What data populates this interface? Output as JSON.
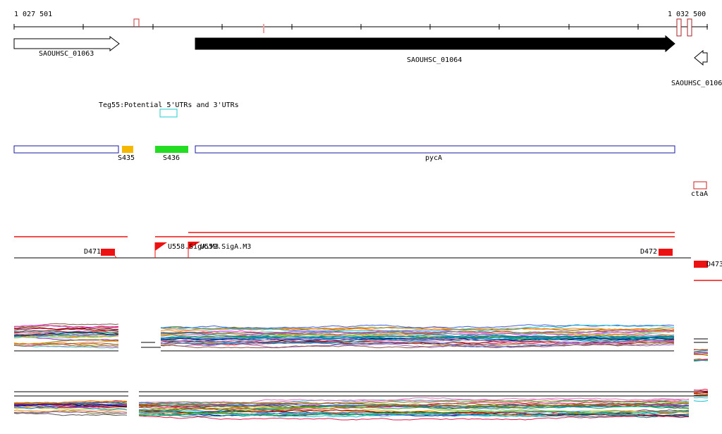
{
  "coords": {
    "start": "1 027 501",
    "end": "1 032 500"
  },
  "genes": [
    {
      "id": "SAOUHSC_01063",
      "label": "SAOUHSC_01063"
    },
    {
      "id": "SAOUHSC_01064",
      "label": "SAOUHSC_01064"
    },
    {
      "id": "SAOUHSC_01065",
      "label": "SAOUHSC_0106"
    }
  ],
  "teg": {
    "label": "Teg55:Potential 5'UTRs and 3'UTRs"
  },
  "segments": {
    "s435": "S435",
    "s436": "S436",
    "pyca": "pycA",
    "ctaa": "ctaA"
  },
  "promoters": {
    "d471": "D471",
    "d472": "D472",
    "d473": "D473",
    "u558": "U558.SigA.M3",
    "u559": "U559.SigA.M3"
  },
  "colors": {
    "axis": "#000000",
    "marker": "#cc2222",
    "orange": "#f5b800",
    "green": "#22dd22",
    "blue": "#1a1aa0",
    "cyan": "#22cccc",
    "red": "#ee1111"
  }
}
